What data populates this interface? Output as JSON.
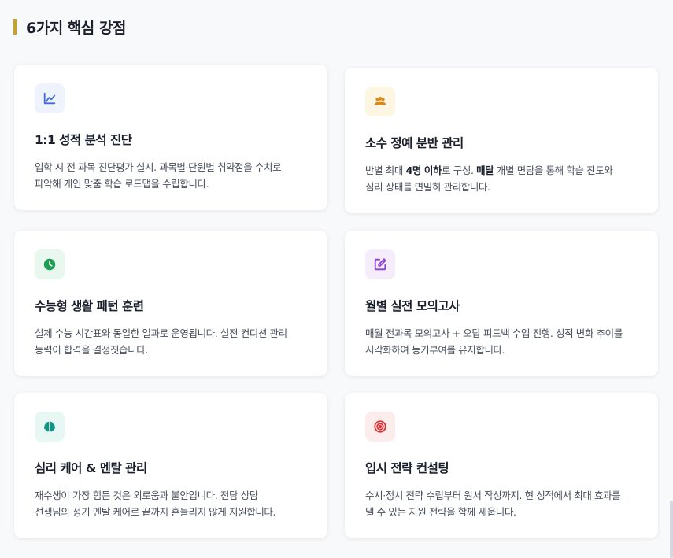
{
  "section": {
    "title": "6가지 핵심 강점",
    "accent_color": "#c9a227"
  },
  "cards": [
    {
      "icon": "chart-line-icon",
      "icon_color": "#3b6fd6",
      "icon_bg": "#eef3fd",
      "title": "1:1 성적 분석 진단",
      "desc": [
        "입학 시 전 과목 진단평가 실시. 과목별·단원별 취약점을 수치로",
        "파악해 개인 맞춤 학습 로드맵을 수립합니다."
      ]
    },
    {
      "icon": "people-group-icon",
      "icon_color": "#d98a1c",
      "icon_bg": "#fdf6e3",
      "title": "소수 정예 분반 관리",
      "desc_parts": [
        "반별 최대 ",
        "4명 이하",
        "로 구성. ",
        "매달",
        " 개별 면담을 통해 학습 진도와"
      ],
      "desc_line2": "심리 상태를 면밀히 관리합니다."
    },
    {
      "icon": "clock-icon",
      "icon_color": "#1f9d55",
      "icon_bg": "#e9f8ef",
      "title": "수능형 생활 패턴 훈련",
      "desc": [
        "실제 수능 시간표와 동일한 일과로 운영됩니다. 실전 컨디션 관리",
        "능력이 합격을 결정짓습니다."
      ]
    },
    {
      "icon": "edit-pencil-icon",
      "icon_color": "#8b3fd6",
      "icon_bg": "#f5edfc",
      "title": "월별 실전 모의고사",
      "desc": [
        "매월 전과목 모의고사 + 오답 피드백 수업 진행. 성적 변화 추이를",
        "시각화하여 동기부여를 유지합니다."
      ]
    },
    {
      "icon": "brain-icon",
      "icon_color": "#149384",
      "icon_bg": "#e6f7f4",
      "title": "심리 케어 & 멘탈 관리",
      "desc": [
        "재수생이 가장 힘든 것은 외로움과 불안입니다. 전담 상담",
        "선생님의 정기 멘탈 케어로 끝까지 흔들리지 않게 지원합니다."
      ]
    },
    {
      "icon": "target-icon",
      "icon_color": "#d63333",
      "icon_bg": "#fdecec",
      "title": "입시 전략 컨설팅",
      "desc": [
        "수시·정시 전략 수립부터 원서 작성까지. 현 성적에서 최대 효과를",
        "낼 수 있는 지원 전략을 함께 세웁니다."
      ]
    }
  ]
}
